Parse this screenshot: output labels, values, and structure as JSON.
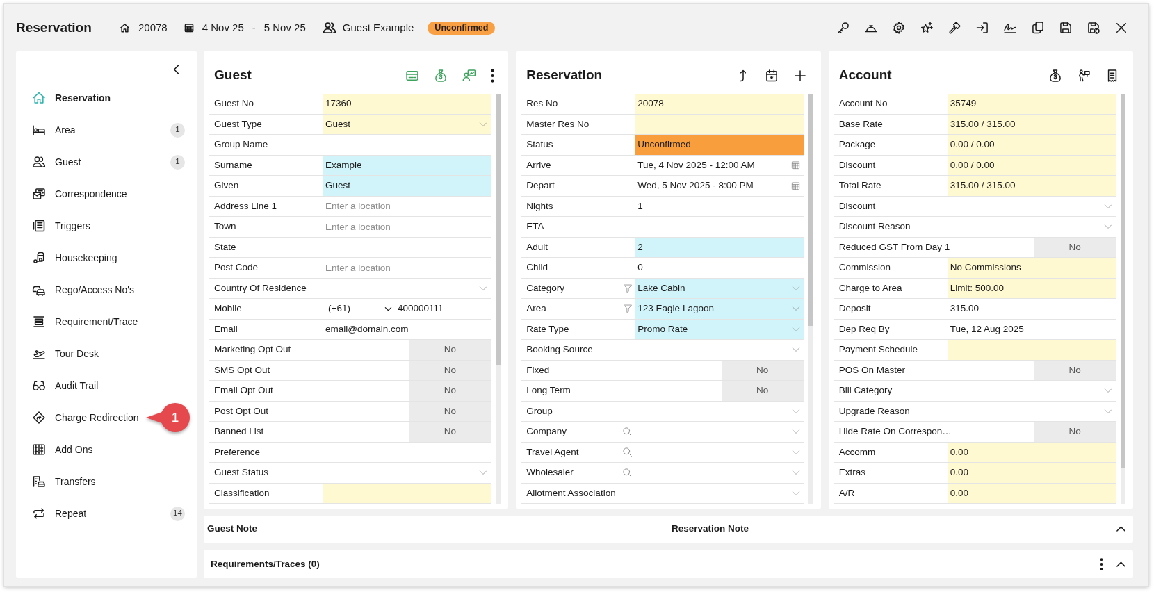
{
  "window": {
    "title": "Reservation",
    "res_no": "20078",
    "arrive": "4 Nov 25",
    "separator": "-",
    "depart": "5 Nov 25",
    "guest": "Guest Example",
    "status": "Unconfirmed"
  },
  "sidebar": {
    "items": [
      {
        "label": "Reservation",
        "selected": true
      },
      {
        "label": "Area",
        "selected": false,
        "count": "1"
      },
      {
        "label": "Guest",
        "selected": false,
        "count": "1"
      },
      {
        "label": "Correspondence",
        "selected": false
      },
      {
        "label": "Triggers",
        "selected": false
      },
      {
        "label": "Housekeeping",
        "selected": false
      },
      {
        "label": "Rego/Access No's",
        "selected": false
      },
      {
        "label": "Requirement/Trace",
        "selected": false
      },
      {
        "label": "Tour Desk",
        "selected": false
      },
      {
        "label": "Audit Trail",
        "selected": false
      },
      {
        "label": "Charge Redirection",
        "selected": false,
        "callout": "1"
      },
      {
        "label": "Add Ons",
        "selected": false
      },
      {
        "label": "Transfers",
        "selected": false
      },
      {
        "label": "Repeat",
        "selected": false,
        "count": "14"
      }
    ]
  },
  "panels": [
    {
      "title": "Guest",
      "rows": [
        {
          "label": "Guest No",
          "link": true,
          "kind": "text",
          "value": "17360",
          "color": "#fff9d2"
        },
        {
          "label": "Guest Type",
          "link": false,
          "kind": "select",
          "value": "Guest",
          "color": "#fff9d2"
        },
        {
          "label": "Group Name",
          "link": false,
          "kind": "text"
        },
        {
          "label": "Surname",
          "link": false,
          "kind": "text",
          "value": "Example",
          "color": "#d0f4fa"
        },
        {
          "label": "Given",
          "link": false,
          "kind": "text",
          "value": "Guest",
          "color": "#d0f4fa"
        },
        {
          "label": "Address Line 1",
          "link": false,
          "kind": "text",
          "placeholder": "Enter a location"
        },
        {
          "label": "Town",
          "link": false,
          "kind": "text",
          "placeholder": "Enter a location"
        },
        {
          "label": "State",
          "link": false,
          "kind": "text"
        },
        {
          "label": "Post Code",
          "link": false,
          "kind": "text",
          "placeholder": "Enter a location"
        },
        {
          "label": "Country Of Residence",
          "link": false,
          "kind": "select"
        },
        {
          "label": "Mobile",
          "link": false,
          "kind": "phone",
          "code": "(+61)",
          "value": "400000111"
        },
        {
          "label": "Email",
          "link": false,
          "kind": "text",
          "value": "email@domain.com"
        },
        {
          "label": "Marketing Opt Out",
          "link": false,
          "kind": "toggle",
          "value": "No",
          "on": false
        },
        {
          "label": "SMS Opt Out",
          "link": false,
          "kind": "toggle",
          "value": "No",
          "on": false
        },
        {
          "label": "Email Opt Out",
          "link": false,
          "kind": "toggle",
          "value": "No",
          "on": false
        },
        {
          "label": "Post Opt Out",
          "link": false,
          "kind": "toggle",
          "value": "No",
          "on": false
        },
        {
          "label": "Banned List",
          "link": false,
          "kind": "toggle",
          "value": "No",
          "on": false
        },
        {
          "label": "Preference",
          "link": false,
          "kind": "text"
        },
        {
          "label": "Guest Status",
          "link": false,
          "kind": "select"
        },
        {
          "label": "Classification",
          "link": false,
          "kind": "text",
          "color": "#fff9d2"
        }
      ]
    },
    {
      "title": "Reservation",
      "rows": [
        {
          "label": "Res No",
          "link": false,
          "kind": "text",
          "value": "20078",
          "color": "#fff9d2"
        },
        {
          "label": "Master Res No",
          "link": false,
          "kind": "text",
          "color": "#fff9d2"
        },
        {
          "label": "Status",
          "link": false,
          "kind": "text",
          "value": "Unconfirmed",
          "color": "#f99e3d"
        },
        {
          "label": "Arrive",
          "link": false,
          "kind": "date",
          "value": "Tue, 4 Nov 2025 - 12:00 AM"
        },
        {
          "label": "Depart",
          "link": false,
          "kind": "date",
          "value": "Wed, 5 Nov 2025 - 8:00 PM"
        },
        {
          "label": "Nights",
          "link": false,
          "kind": "text",
          "value": "1"
        },
        {
          "label": "ETA",
          "link": false,
          "kind": "text"
        },
        {
          "label": "Adult",
          "link": false,
          "kind": "text",
          "value": "2",
          "color": "#d0f4fa"
        },
        {
          "label": "Child",
          "link": false,
          "kind": "text",
          "value": "0"
        },
        {
          "label": "Category",
          "link": false,
          "kind": "select",
          "filter": true,
          "value": "Lake Cabin",
          "color": "#d0f4fa"
        },
        {
          "label": "Area",
          "link": false,
          "kind": "select",
          "filter": true,
          "value": "123 Eagle Lagoon",
          "color": "#d0f4fa"
        },
        {
          "label": "Rate Type",
          "link": false,
          "kind": "select",
          "value": "Promo Rate",
          "color": "#d0f4fa"
        },
        {
          "label": "Booking Source",
          "link": false,
          "kind": "select"
        },
        {
          "label": "Fixed",
          "link": false,
          "kind": "toggle",
          "value": "No",
          "on": false
        },
        {
          "label": "Long Term",
          "link": false,
          "kind": "toggle",
          "value": "No",
          "on": false
        },
        {
          "label": "Group",
          "link": true,
          "kind": "select"
        },
        {
          "label": "Company",
          "link": true,
          "kind": "select",
          "lookup": true
        },
        {
          "label": "Travel Agent",
          "link": true,
          "kind": "select",
          "lookup": true
        },
        {
          "label": "Wholesaler",
          "link": true,
          "kind": "select",
          "lookup": true
        },
        {
          "label": "Allotment Association",
          "link": false,
          "kind": "select"
        }
      ]
    },
    {
      "title": "Account",
      "rows": [
        {
          "label": "Account No",
          "link": false,
          "kind": "text",
          "value": "35749",
          "color": "#fff9d2"
        },
        {
          "label": "Base Rate",
          "link": true,
          "kind": "text",
          "value": "315.00 / 315.00",
          "color": "#fff9d2"
        },
        {
          "label": "Package",
          "link": true,
          "kind": "text",
          "value": "0.00 / 0.00",
          "color": "#fff9d2"
        },
        {
          "label": "Discount",
          "link": false,
          "kind": "text",
          "value": "0.00 / 0.00",
          "color": "#fff9d2"
        },
        {
          "label": "Total Rate",
          "link": true,
          "kind": "text",
          "value": "315.00 / 315.00",
          "color": "#fff9d2"
        },
        {
          "label": "Discount",
          "link": true,
          "kind": "select"
        },
        {
          "label": "Discount Reason",
          "link": false,
          "kind": "select"
        },
        {
          "label": "Reduced GST From Day 1",
          "link": false,
          "kind": "toggle",
          "value": "No",
          "on": false
        },
        {
          "label": "Commission",
          "link": true,
          "kind": "text",
          "value": "No Commissions",
          "color": "#fff9d2"
        },
        {
          "label": "Charge to Area",
          "link": true,
          "kind": "text",
          "value": "Limit: 500.00",
          "color": "#fff9d2"
        },
        {
          "label": "Deposit",
          "link": false,
          "kind": "text",
          "value": "315.00"
        },
        {
          "label": "Dep Req By",
          "link": false,
          "kind": "text",
          "value": "Tue, 12 Aug 2025"
        },
        {
          "label": "Payment Schedule",
          "link": true,
          "kind": "text",
          "color": "#fff9d2"
        },
        {
          "label": "POS On Master",
          "link": false,
          "kind": "toggle",
          "value": "No",
          "on": false
        },
        {
          "label": "Bill Category",
          "link": false,
          "kind": "select"
        },
        {
          "label": "Upgrade Reason",
          "link": false,
          "kind": "select"
        },
        {
          "label": "Hide Rate On Correspon…",
          "link": false,
          "kind": "toggle",
          "value": "No",
          "on": false
        },
        {
          "label": "Accomm",
          "link": true,
          "kind": "text",
          "value": "0.00",
          "color": "#fff9d2"
        },
        {
          "label": "Extras",
          "link": true,
          "kind": "text",
          "value": "0.00",
          "color": "#fff9d2"
        },
        {
          "label": "A/R",
          "link": false,
          "kind": "text",
          "value": "0.00",
          "color": "#fff9d2"
        }
      ]
    }
  ],
  "notes_bar": {
    "guest_note": "Guest Note",
    "reservation_note": "Reservation Note"
  },
  "requirements_bar": {
    "title": "Requirements/Traces (0)"
  }
}
